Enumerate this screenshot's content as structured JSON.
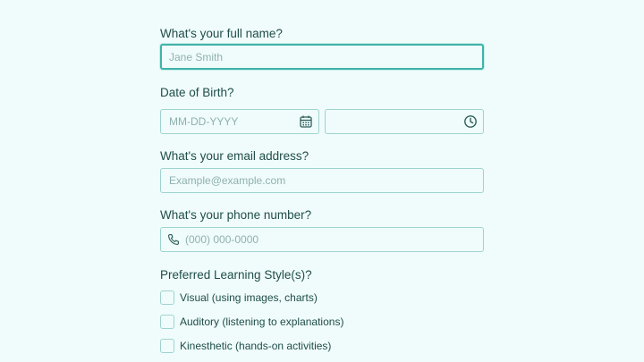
{
  "full_name": {
    "label": "What's your full name?",
    "placeholder": "Jane Smith",
    "value": ""
  },
  "dob": {
    "label": "Date of Birth?",
    "date_placeholder": "MM-DD-YYYY",
    "date_icon": "calendar-icon",
    "time_placeholder": "",
    "time_icon": "clock-icon"
  },
  "email": {
    "label": "What's your email address?",
    "placeholder": "Example@example.com"
  },
  "phone": {
    "label": "What's your phone number?",
    "placeholder": "(000) 000-0000",
    "icon": "phone-icon"
  },
  "learning_style": {
    "label": "Preferred Learning Style(s)?",
    "options": [
      {
        "label": "Visual (using images, charts)",
        "checked": false
      },
      {
        "label": "Auditory (listening to explanations)",
        "checked": false
      },
      {
        "label": "Kinesthetic (hands-on activities)",
        "checked": false
      }
    ]
  },
  "colors": {
    "background": "#effcfb",
    "text": "#1f4d4a",
    "border": "#9fd3cf",
    "focus": "#3fb2aa",
    "placeholder": "#8fb1ae"
  }
}
